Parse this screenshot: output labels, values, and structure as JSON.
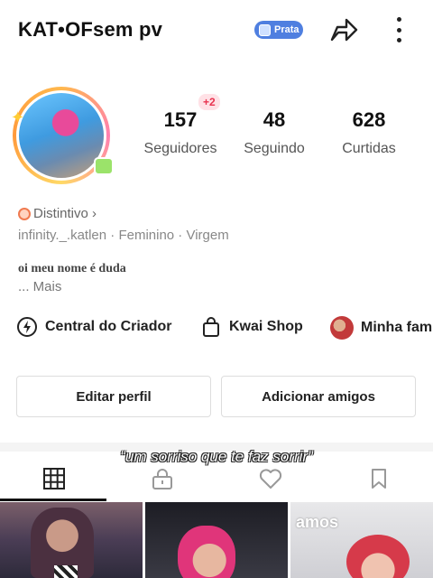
{
  "header": {
    "username": "KAT•OFsem pv",
    "level_badge": "Prata"
  },
  "profile": {
    "new_followers_badge": "+2",
    "stats": [
      {
        "value": "157",
        "label": "Seguidores"
      },
      {
        "value": "48",
        "label": "Seguindo"
      },
      {
        "value": "628",
        "label": "Curtidas"
      }
    ],
    "distintivo_label": "Distintivo ›",
    "meta_line": "infinity._.katlen  ·  Feminino  ·  Virgem",
    "bio": "oi meu nome é duda",
    "more_label": "...  Mais"
  },
  "quick_links": [
    {
      "label": "Central do Criador",
      "icon": "lightning-icon"
    },
    {
      "label": "Kwai Shop",
      "icon": "shopping-bag-icon"
    },
    {
      "label": "Minha fam",
      "icon": "family-avatar"
    }
  ],
  "actions": {
    "edit_profile": "Editar perfil",
    "add_friends": "Adicionar amigos"
  },
  "caption": "“um sorriso que te faz sorrir”",
  "tabs": [
    {
      "name": "grid",
      "icon": "grid-icon",
      "active": true
    },
    {
      "name": "private",
      "icon": "lock-icon",
      "active": false
    },
    {
      "name": "liked",
      "icon": "heart-icon",
      "active": false
    },
    {
      "name": "saved",
      "icon": "bookmark-icon",
      "active": false
    }
  ],
  "grid_thumbnails": [
    {
      "overlay_text": ""
    },
    {
      "overlay_text": ""
    },
    {
      "overlay_text": "amos"
    }
  ],
  "colors": {
    "level_badge_bg": "#4f7fe0",
    "notification_red": "#e8334f",
    "distintivo_orange": "#f07a50"
  }
}
